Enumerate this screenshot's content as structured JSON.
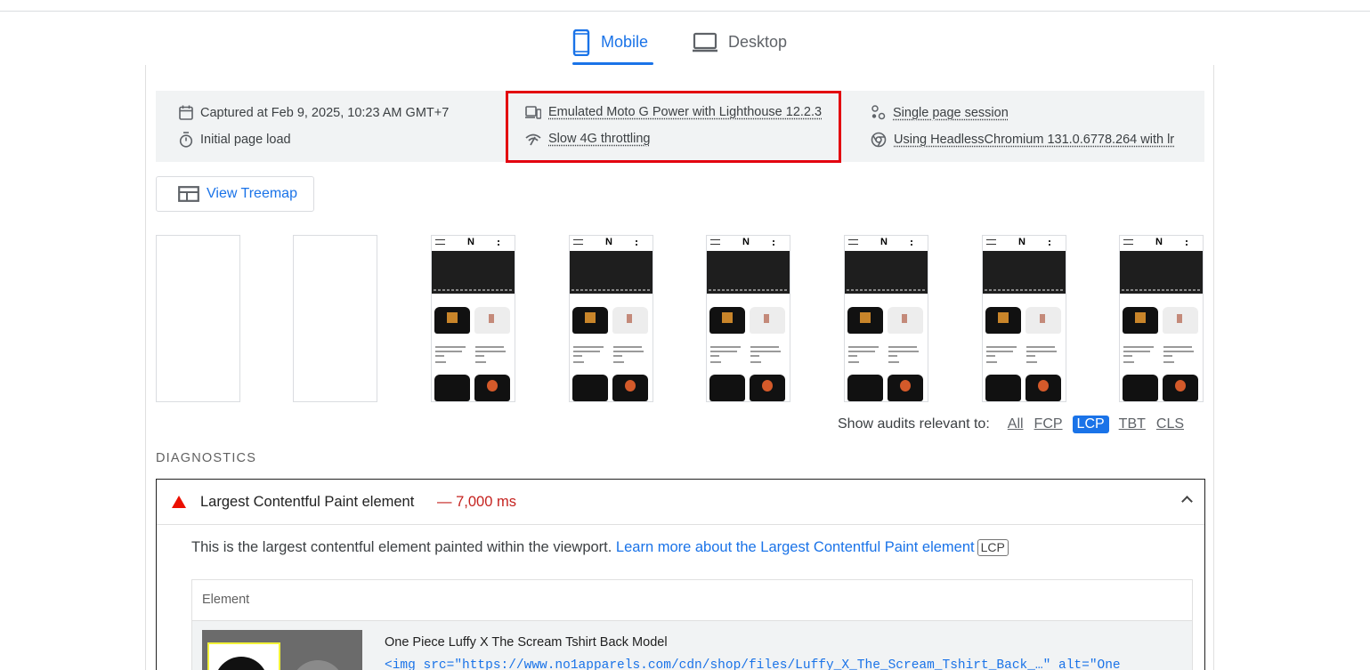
{
  "tabs": [
    {
      "label": "Mobile",
      "icon": "smartphone-icon",
      "active": true
    },
    {
      "label": "Desktop",
      "icon": "monitor-icon",
      "active": false
    }
  ],
  "meta": {
    "captured": "Captured at Feb 9, 2025, 10:23 AM GMT+7",
    "page_load": "Initial page load",
    "device": "Emulated Moto G Power with Lighthouse 12.2.3",
    "throttling": "Slow 4G throttling",
    "session": "Single page session",
    "browser": "Using HeadlessChromium 131.0.6778.264 with lr"
  },
  "treemap_button": "View Treemap",
  "filmstrip": {
    "thumb_logo": "N"
  },
  "filters": {
    "label": "Show audits relevant to:",
    "options": [
      "All",
      "FCP",
      "LCP",
      "TBT",
      "CLS"
    ],
    "active": "LCP"
  },
  "diagnostics_title": "DIAGNOSTICS",
  "audit": {
    "title": "Largest Contentful Paint element",
    "value": "— 7,000 ms",
    "description": "This is the largest contentful element painted within the viewport. ",
    "learn_more": "Learn more about the Largest Contentful Paint element",
    "badge": "LCP",
    "table_header": "Element",
    "element_name": "One Piece Luffy X The Scream Tshirt Back Model",
    "element_snippet": "<img src=\"https://www.no1apparels.com/cdn/shop/files/Luffy_X_The_Scream_Tshirt_Back_…\" alt=\"One"
  },
  "colors": {
    "accent": "#1a73e8",
    "highlight": "#e3000f",
    "fail": "#eb0f00"
  }
}
